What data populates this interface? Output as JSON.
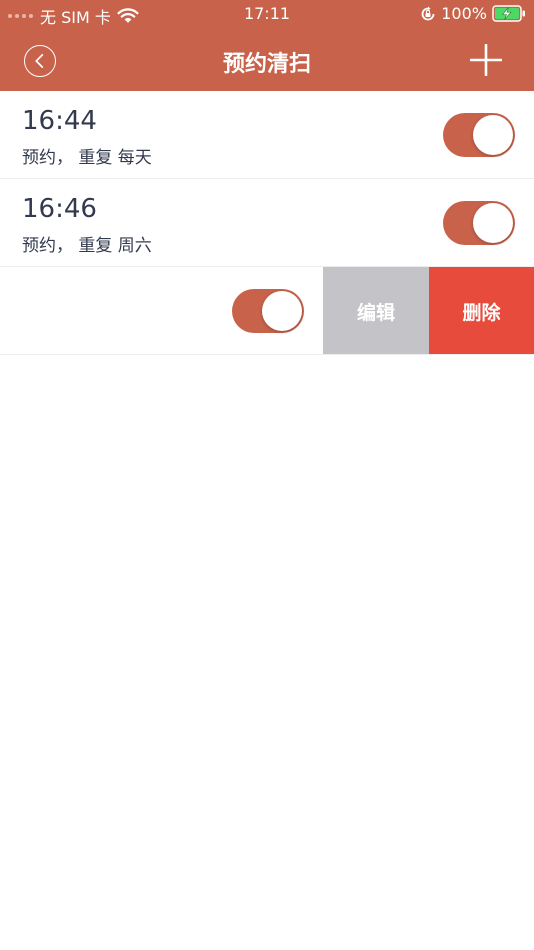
{
  "status_bar": {
    "carrier": "无 SIM 卡",
    "time": "17:11",
    "battery": "100%"
  },
  "nav": {
    "title": "预约清扫",
    "back_icon": "chevron-left-circle-icon",
    "add_icon": "plus-icon"
  },
  "colors": {
    "accent": "#c8624a",
    "edit_action": "#c3c3c8",
    "delete_action": "#e64b3c",
    "text": "#333a4e"
  },
  "schedules": [
    {
      "time": "16:44",
      "description": "预约， 重复  每天",
      "enabled": true
    },
    {
      "time": "16:46",
      "description": "预约， 重复  周六",
      "enabled": true
    },
    {
      "time": "",
      "description": "",
      "enabled": true
    }
  ],
  "row_actions": {
    "edit_label": "编辑",
    "delete_label": "删除"
  }
}
